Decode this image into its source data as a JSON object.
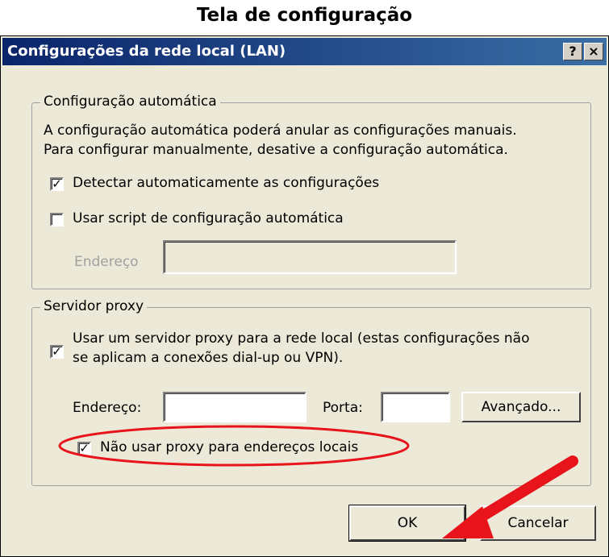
{
  "caption": "Tela de configuração",
  "dialog": {
    "title": "Configurações da rede local (LAN)",
    "help_button": "?",
    "close_button": "×"
  },
  "auto_config": {
    "legend": "Configuração automática",
    "description_line1": "A configuração automática poderá anular as configurações manuais.",
    "description_line2": "Para configurar manualmente, desative a configuração automática.",
    "detect_label": "Detectar automaticamente as configurações",
    "detect_checked": true,
    "script_label": "Usar script de configuração automática",
    "script_checked": false,
    "address_label": "Endereço",
    "address_value": ""
  },
  "proxy": {
    "legend": "Servidor proxy",
    "use_proxy_line1": "Usar um servidor proxy para a rede local (estas configurações não",
    "use_proxy_line2": "se aplicam a conexões dial-up ou VPN).",
    "use_proxy_checked": true,
    "address_label": "Endereço:",
    "address_value": "",
    "port_label": "Porta:",
    "port_value": "",
    "advanced_button": "Avançado...",
    "bypass_label": "Não usar proxy para endereços locais",
    "bypass_checked": true
  },
  "buttons": {
    "ok": "OK",
    "cancel": "Cancelar"
  },
  "annotation_color": "#e8141b"
}
